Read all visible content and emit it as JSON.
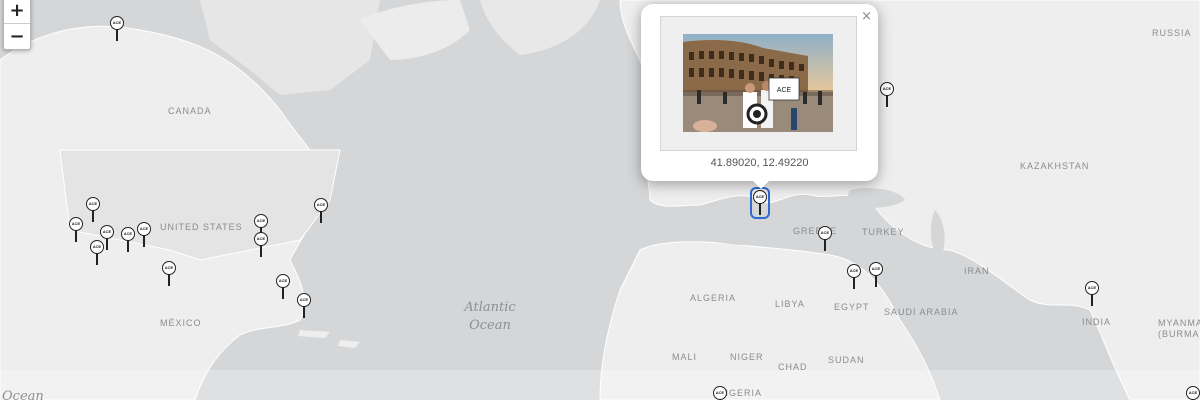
{
  "map": {
    "zoom": {
      "in_label": "+",
      "out_label": "−"
    },
    "countries": {
      "canada": "CANADA",
      "united_states": "UNITED STATES",
      "mexico": "MÉXICO",
      "russia": "RUSSIA",
      "kazakhstan": "KAZAKHSTAN",
      "turkey": "TURKEY",
      "greece": "GREECE",
      "iran": "IRAN",
      "india": "INDIA",
      "myanmar": "MYANMA (BURMA)",
      "algeria": "ALGERIA",
      "libya": "LIBYA",
      "egypt": "EGYPT",
      "saudi_arabia": "SAUDI ARABIA",
      "mali": "MALI",
      "niger": "NIGER",
      "chad": "CHAD",
      "sudan": "SUDAN",
      "nigeria": "NIGERIA"
    },
    "oceans": {
      "atlantic_line1": "Atlantic",
      "atlantic_line2": "Ocean",
      "pacific": "Ocean"
    },
    "marker_text": "ACE"
  },
  "popup": {
    "close_label": "×",
    "coords_text": "41.89020, 12.49220",
    "photo_sign_text": "ACE"
  }
}
